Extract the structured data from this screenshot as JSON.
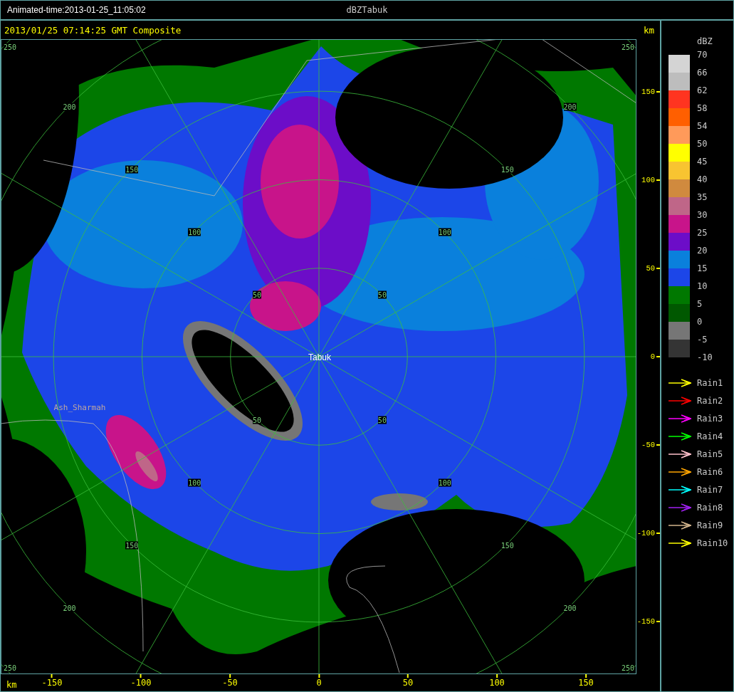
{
  "window": {
    "animated_time": "Animated-time:2013-01-25_11:05:02",
    "title": "dBZTabuk"
  },
  "plot": {
    "timestamp": "2013/01/25 07:14:25 GMT Composite",
    "unit_top": "km",
    "unit_bottom": "km",
    "y_ticks": [
      "150",
      "100",
      "50",
      "0",
      "-50",
      "-100",
      "-150"
    ],
    "x_ticks": [
      "-150",
      "-100",
      "-50",
      "0",
      "50",
      "100",
      "150"
    ],
    "rings": [
      {
        "labels": [
          "50",
          "50",
          "50",
          "50"
        ]
      },
      {
        "labels": [
          "100",
          "100",
          "100",
          "100"
        ]
      },
      {
        "labels": [
          "150",
          "150",
          "150",
          "150"
        ]
      },
      {
        "labels": [
          "200",
          "200",
          "200",
          "200"
        ]
      },
      {
        "labels": [
          "250",
          "250",
          "250",
          "250"
        ]
      }
    ],
    "places": [
      {
        "name": "Tabuk",
        "kind": "radar"
      },
      {
        "name": "Ash_Sharmah",
        "kind": "town"
      }
    ]
  },
  "legend": {
    "title": "dBZ",
    "scale_labels": [
      "70",
      "66",
      "62",
      "58",
      "54",
      "50",
      "45",
      "40",
      "35",
      "30",
      "25",
      "20",
      "15",
      "10",
      "5",
      "0",
      "-5",
      "-10"
    ],
    "color_bins": [
      {
        "color": "#d4d4d4"
      },
      {
        "color": "#bdbdbd"
      },
      {
        "color": "#ff3420"
      },
      {
        "color": "#ff5f00"
      },
      {
        "color": "#ff9a5a"
      },
      {
        "color": "#ffff00"
      },
      {
        "color": "#f8c431"
      },
      {
        "color": "#d08a3e"
      },
      {
        "color": "#bf6688"
      },
      {
        "color": "#c8148a"
      },
      {
        "color": "#6c0dc8"
      },
      {
        "color": "#0a80dc"
      },
      {
        "color": "#1c46e8"
      },
      {
        "color": "#007800"
      },
      {
        "color": "#005800"
      },
      {
        "color": "#767676"
      },
      {
        "color": "#343434"
      }
    ],
    "tracks": [
      {
        "label": "Rain1",
        "color": "#ffff00"
      },
      {
        "label": "Rain2",
        "color": "#ff0000"
      },
      {
        "label": "Rain3",
        "color": "#ff00ff"
      },
      {
        "label": "Rain4",
        "color": "#00ff00"
      },
      {
        "label": "Rain5",
        "color": "#ffc0cb"
      },
      {
        "label": "Rain6",
        "color": "#ffa500"
      },
      {
        "label": "Rain7",
        "color": "#00ffff"
      },
      {
        "label": "Rain8",
        "color": "#a020f0"
      },
      {
        "label": "Rain9",
        "color": "#d2b48c"
      },
      {
        "label": "Rain10",
        "color": "#ffff00"
      }
    ]
  }
}
